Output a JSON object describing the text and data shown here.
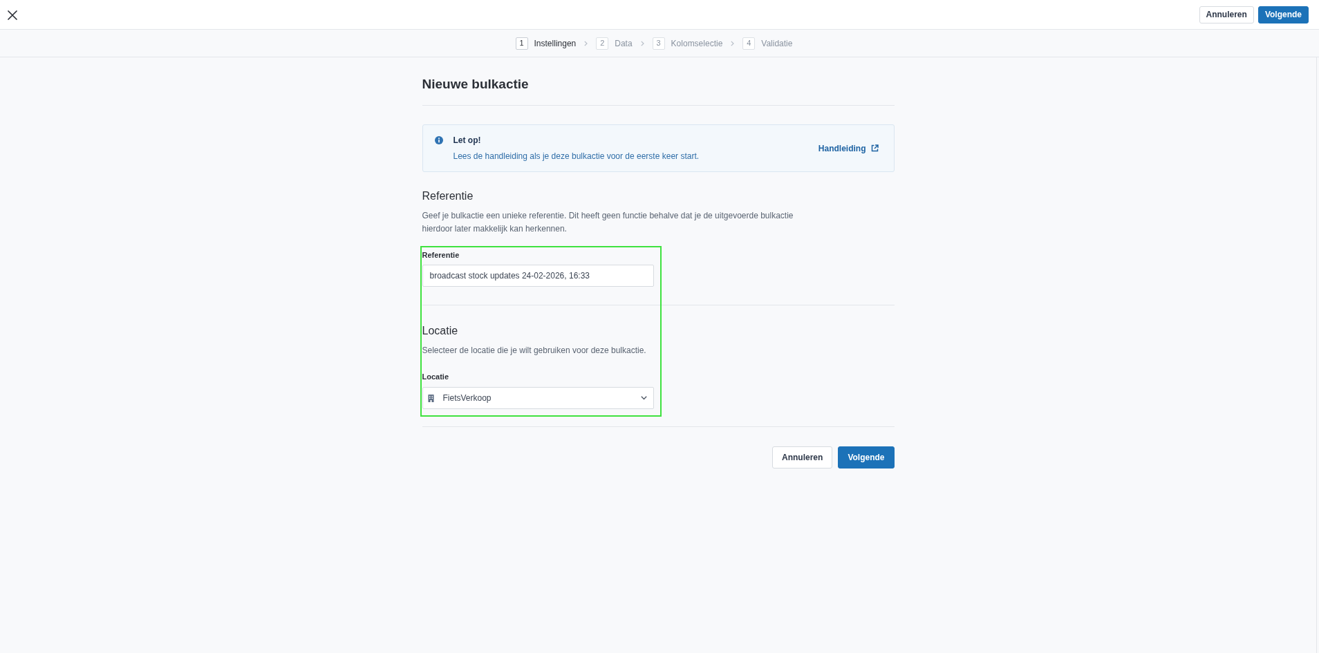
{
  "header": {
    "buttons": [
      {
        "label": "Annuleren",
        "kind": "secondary"
      },
      {
        "label": "Volgende",
        "kind": "primary"
      }
    ]
  },
  "steps": [
    {
      "number": "1",
      "label": "Instellingen",
      "selected": true
    },
    {
      "number": "2",
      "label": "Data",
      "selected": false
    },
    {
      "number": "3",
      "label": "Kolomselectie",
      "selected": false
    },
    {
      "number": "4",
      "label": "Validatie",
      "selected": false
    }
  ],
  "page": {
    "title": "Nieuwe bulkactie"
  },
  "notice": {
    "title": "Let op!",
    "text": "Lees de handleiding als je deze bulkactie voor de eerste keer start.",
    "link": "Handleiding"
  },
  "sections": [
    {
      "heading": "Referentie",
      "description": "Geef je bulkactie een unieke referentie. Dit heeft geen functie behalve dat je de uitgevoerde bulkactie hierdoor later makkelijk kan herkennen.",
      "field": {
        "kind": "text",
        "label": "Referentie",
        "value": "broadcast stock updates 24-02-2026, 16:33"
      }
    },
    {
      "heading": "Locatie",
      "description": "Selecteer de locatie die je wilt gebruiken voor deze bulkactie.",
      "field": {
        "kind": "select",
        "label": "Locatie",
        "value": "FietsVerkoop"
      }
    }
  ],
  "footer": {
    "buttons": [
      {
        "label": "Annuleren",
        "kind": "secondary"
      },
      {
        "label": "Volgende",
        "kind": "primary"
      }
    ]
  }
}
